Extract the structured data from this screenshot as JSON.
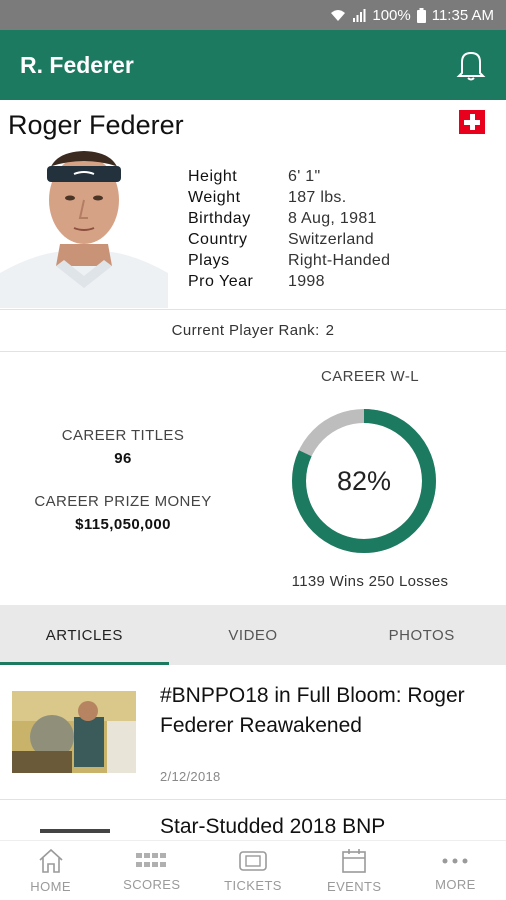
{
  "status_bar": {
    "battery": "100%",
    "time": "11:35 AM"
  },
  "app_bar": {
    "title": "R. Federer"
  },
  "profile": {
    "name": "Roger Federer",
    "stats": [
      {
        "label": "Height",
        "value": "6' 1\""
      },
      {
        "label": "Weight",
        "value": "187 lbs."
      },
      {
        "label": "Birthday",
        "value": "8 Aug, 1981"
      },
      {
        "label": "Country",
        "value": "Switzerland"
      },
      {
        "label": "Plays",
        "value": "Right-Handed"
      },
      {
        "label": "Pro Year",
        "value": "1998"
      }
    ]
  },
  "rank": {
    "label": "Current Player Rank:",
    "value": "2"
  },
  "career": {
    "titles_label": "CAREER TITLES",
    "titles_value": "96",
    "prize_label": "CAREER PRIZE MONEY",
    "prize_value": "$115,050,000",
    "wl_title": "CAREER W-L",
    "wl_percent_text": "82%",
    "wl_fraction": 0.82,
    "wl_summary": "1139 Wins 250 Losses"
  },
  "colors": {
    "accent": "#1c7a60",
    "ring_rest": "#bdbdbd"
  },
  "tabs": [
    {
      "label": "ARTICLES",
      "active": true
    },
    {
      "label": "VIDEO",
      "active": false
    },
    {
      "label": "PHOTOS",
      "active": false
    }
  ],
  "articles": [
    {
      "title": "#BNPPO18 in Full Bloom: Roger Federer Reawakened",
      "date": "2/12/2018"
    },
    {
      "title": "Star-Studded 2018 BNP"
    }
  ],
  "bottom_nav": [
    {
      "label": "HOME",
      "icon": "home-icon"
    },
    {
      "label": "SCORES",
      "icon": "scores-icon"
    },
    {
      "label": "TICKETS",
      "icon": "tickets-icon"
    },
    {
      "label": "EVENTS",
      "icon": "events-icon"
    },
    {
      "label": "MORE",
      "icon": "more-icon"
    }
  ]
}
